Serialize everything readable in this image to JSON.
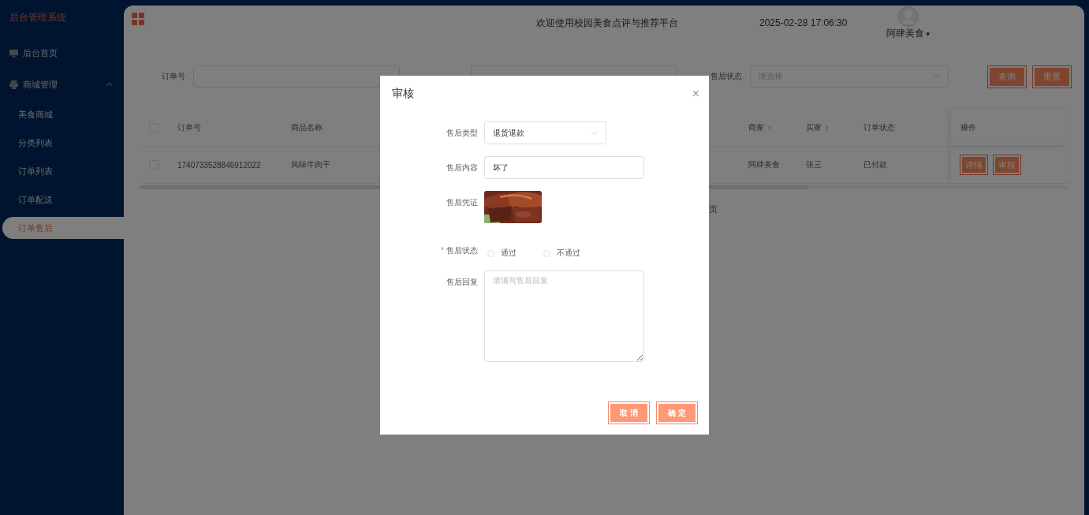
{
  "sidebar": {
    "title": "后台管理系统",
    "items": [
      {
        "label": "后台首页"
      },
      {
        "label": "商城管理",
        "expanded": true,
        "children": [
          {
            "label": "美食商城",
            "selected": false
          },
          {
            "label": "分类列表",
            "selected": false
          },
          {
            "label": "订单列表",
            "selected": false
          },
          {
            "label": "订单配送",
            "selected": false
          },
          {
            "label": "订单售后",
            "selected": true
          }
        ]
      }
    ]
  },
  "header": {
    "title": "欢迎使用校园美食点评与推荐平台",
    "datetime": "2025-02-28 17:06:30",
    "user": "阿肆美食",
    "user_caret": "▾"
  },
  "filters": {
    "order_label": "订单号",
    "status_label": "售后状态",
    "status_placeholder": "请选择",
    "buttons": [
      "查询",
      "重置"
    ]
  },
  "table": {
    "select_all_checked": false,
    "columns": [
      {
        "label": "订单号",
        "sortable": false
      },
      {
        "label": "商品名称",
        "sortable": false
      },
      {
        "label": "商家",
        "sortable": true
      },
      {
        "label": "买家",
        "sortable": true
      },
      {
        "label": "订单状态",
        "sortable": false
      },
      {
        "label": "操作",
        "sortable": false
      }
    ],
    "rows": [
      {
        "checked": false,
        "cells": [
          "1740733528846912022",
          "风味牛肉干",
          "阿肆美食",
          "张三",
          "已付款"
        ],
        "actions": [
          "详情",
          "审核"
        ]
      }
    ]
  },
  "pagination_fragment": "页",
  "dialog": {
    "title": "审核",
    "close": "×",
    "fields": [
      {
        "kind": "select",
        "label": "售后类型",
        "value": "退货退款"
      },
      {
        "kind": "input",
        "label": "售后内容",
        "value": "坏了"
      },
      {
        "label": "售后凭证"
      },
      {
        "kind": "radio",
        "label": "售后状态",
        "required_mark": "*",
        "options": [
          {
            "label": "通过",
            "selected": false
          },
          {
            "label": "不通过",
            "selected": false
          }
        ]
      },
      {
        "kind": "textarea",
        "label": "售后回复",
        "placeholder": "请填写售后回复"
      }
    ],
    "buttons": [
      "取 消",
      "确 定"
    ]
  }
}
